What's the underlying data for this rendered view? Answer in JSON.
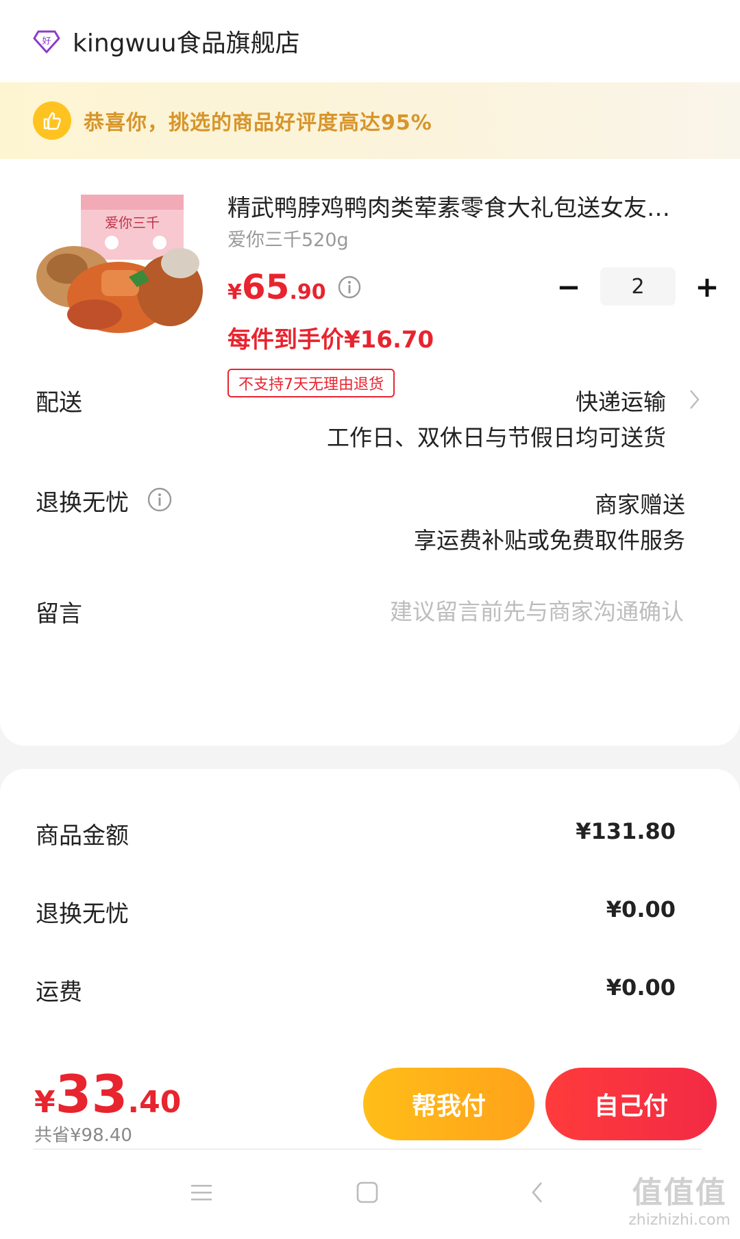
{
  "store": {
    "name": "kingwuu食品旗舰店",
    "icon": "diamond-good-icon"
  },
  "banner": {
    "text": "恭喜你，挑选的商品好评度高达95%",
    "icon": "thumbs-up-icon"
  },
  "product": {
    "title": "精武鸭脖鸡鸭肉类荤素零食大礼包送女友…",
    "spec": "爱你三千520g",
    "price_symbol": "¥",
    "price_int": "65",
    "price_dec": ".90",
    "unit_price": "每件到手价¥16.70",
    "tag": "不支持7天无理由退货",
    "quantity": "2",
    "minus": "−",
    "plus": "+",
    "box_text": "爱你三千"
  },
  "delivery": {
    "label": "配送",
    "method": "快递运输",
    "detail": "工作日、双休日与节假日均可送货"
  },
  "return_worry_free": {
    "label": "退换无忧",
    "provider": "商家赠送",
    "detail": "享运费补贴或免费取件服务"
  },
  "message": {
    "label": "留言",
    "placeholder": "建议留言前先与商家沟通确认"
  },
  "summary": {
    "items": [
      {
        "label": "商品金额",
        "value": "¥131.80"
      },
      {
        "label": "退换无忧",
        "value": "¥0.00"
      },
      {
        "label": "运费",
        "value": "¥0.00"
      }
    ]
  },
  "checkout": {
    "total_symbol": "¥",
    "total_int": "33",
    "total_dec": ".40",
    "saved": "共省¥98.40",
    "help_pay_label": "帮我付",
    "self_pay_label": "自己付"
  },
  "watermark": {
    "logo": "值值值",
    "url": "zhizhizhi.com"
  },
  "colors": {
    "accent_red": "#e8242f",
    "gold": "#ffbe18",
    "banner_text": "#d7952b"
  }
}
